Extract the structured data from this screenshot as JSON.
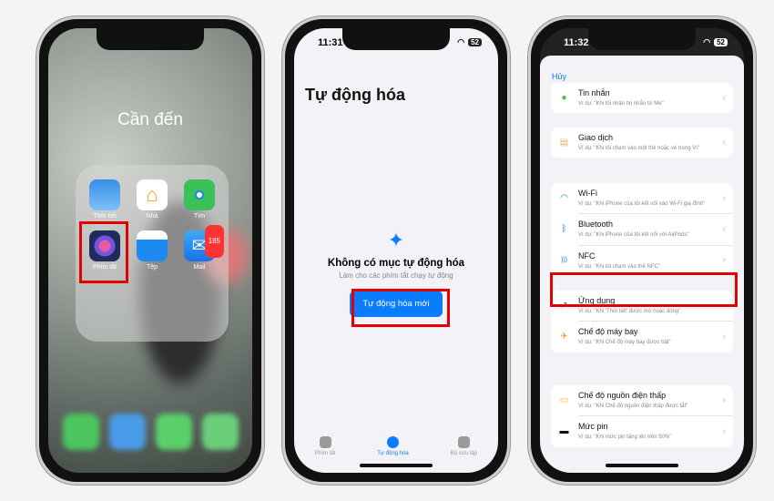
{
  "phone1": {
    "folder_title": "Cần đến",
    "apps": [
      {
        "label": "Thời tiết",
        "icon": "weather-icon"
      },
      {
        "label": "Nhà",
        "icon": "home-icon"
      },
      {
        "label": "Tìm",
        "icon": "find-my-icon"
      },
      {
        "label": "Phím tắt",
        "icon": "shortcuts-icon"
      },
      {
        "label": "Tệp",
        "icon": "files-icon"
      },
      {
        "label": "Mail",
        "icon": "mail-icon",
        "badge": "185"
      }
    ]
  },
  "phone2": {
    "time": "11:31",
    "battery": "52",
    "title": "Tự động hóa",
    "empty_title": "Không có mục tự động hóa",
    "empty_subtitle": "Làm cho các phím tắt chạy tự động",
    "new_button": "Tự động hóa mới",
    "tabs": [
      {
        "label": "Phím tắt"
      },
      {
        "label": "Tự động hóa",
        "active": true
      },
      {
        "label": "Bộ sưu tập"
      }
    ]
  },
  "phone3": {
    "time": "11:32",
    "battery": "52",
    "cancel": "Hủy",
    "groups": [
      [
        {
          "title": "Tin nhắn",
          "desc": "Ví dụ: \"Khi tôi nhận tin nhắn từ Mẹ\"",
          "icon": "messages-icon"
        }
      ],
      [
        {
          "title": "Giao dịch",
          "desc": "Ví dụ: \"Khi tôi chạm vào một thẻ hoặc vé trong Ví\"",
          "icon": "wallet-icon"
        }
      ],
      [
        {
          "title": "Wi-Fi",
          "desc": "Ví dụ: \"Khi iPhone của tôi kết nối vào Wi-Fi gia đình\"",
          "icon": "wifi-icon"
        },
        {
          "title": "Bluetooth",
          "desc": "Ví dụ: \"Khi iPhone của tôi kết nối với AirPods\"",
          "icon": "bluetooth-icon"
        },
        {
          "title": "NFC",
          "desc": "Ví dụ: \"Khi tôi chạm vào thẻ NFC\"",
          "icon": "nfc-icon"
        }
      ],
      [
        {
          "title": "Ứng dụng",
          "desc": "Ví dụ: \"Khi 'Thời tiết' được mở hoặc đóng\"",
          "icon": "app-icon"
        },
        {
          "title": "Chế độ máy bay",
          "desc": "Ví dụ: \"Khi Chế độ máy bay được bật\"",
          "icon": "airplane-icon"
        }
      ],
      [
        {
          "title": "Chế độ nguồn điện thấp",
          "desc": "Ví dụ: \"Khi Chế độ nguồn điện thấp được tắt\"",
          "icon": "low-power-icon"
        },
        {
          "title": "Mức pin",
          "desc": "Ví dụ: \"Khi mức pin tăng lên trên 50%\"",
          "icon": "battery-level-icon"
        }
      ]
    ]
  },
  "colors": {
    "accent": "#0a7cff",
    "highlight": "#e30000"
  }
}
